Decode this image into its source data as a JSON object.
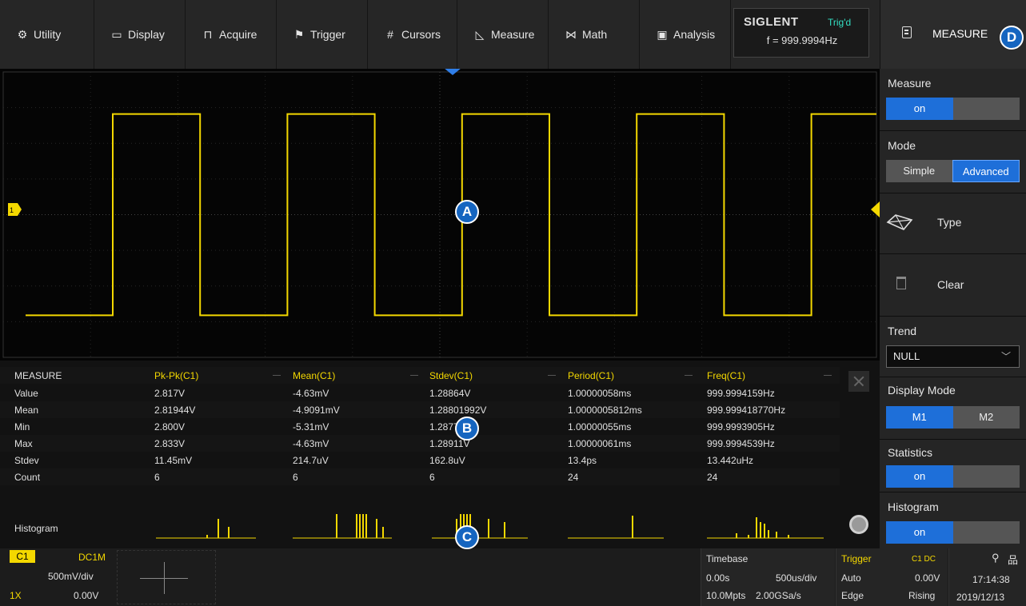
{
  "menu": [
    {
      "label": "Utility",
      "icon": "gear-icon"
    },
    {
      "label": "Display",
      "icon": "monitor-icon"
    },
    {
      "label": "Acquire",
      "icon": "acquire-icon"
    },
    {
      "label": "Trigger",
      "icon": "flag-icon"
    },
    {
      "label": "Cursors",
      "icon": "hash-icon"
    },
    {
      "label": "Measure",
      "icon": "measure-icon"
    },
    {
      "label": "Math",
      "icon": "math-icon"
    },
    {
      "label": "Analysis",
      "icon": "analysis-icon"
    }
  ],
  "brand": {
    "name": "SIGLENT",
    "trig_status": "Trig'd",
    "frequency": "f = 999.9994Hz"
  },
  "panel": {
    "title": "MEASURE",
    "measure_label": "Measure",
    "measure_state": "on",
    "mode_label": "Mode",
    "mode_simple": "Simple",
    "mode_advanced": "Advanced",
    "type_label": "Type",
    "clear_label": "Clear",
    "trend_label": "Trend",
    "trend_value": "NULL",
    "display_mode_label": "Display Mode",
    "display_m1": "M1",
    "display_m2": "M2",
    "statistics_label": "Statistics",
    "statistics_state": "on",
    "histogram_label": "Histogram",
    "histogram_state": "on"
  },
  "waveform": {
    "channel_marker": "1",
    "trace_color": "#f4d800",
    "high_level": 1.41,
    "low_level": -1.41,
    "period_ms": 1.0,
    "volts_per_div": 0.5,
    "time_per_div_us": 500
  },
  "measure": {
    "header": [
      "MEASURE",
      "Pk-Pk(C1)",
      "Mean(C1)",
      "Stdev(C1)",
      "Period(C1)",
      "Freq(C1)"
    ],
    "rows": [
      {
        "label": "Value",
        "cells": [
          "2.817V",
          "-4.63mV",
          "1.28864V",
          "1.00000058ms",
          "999.9994159Hz"
        ]
      },
      {
        "label": "Mean",
        "cells": [
          "2.81944V",
          "-4.9091mV",
          "1.28801992V",
          "1.0000005812ms",
          "999.999418770Hz"
        ]
      },
      {
        "label": "Min",
        "cells": [
          "2.800V",
          "-5.31mV",
          "1.28771V",
          "1.00000055ms",
          "999.9993905Hz"
        ]
      },
      {
        "label": "Max",
        "cells": [
          "2.833V",
          "-4.63mV",
          "1.28911V",
          "1.00000061ms",
          "999.9994539Hz"
        ]
      },
      {
        "label": "Stdev",
        "cells": [
          "11.45mV",
          "214.7uV",
          "162.8uV",
          "13.4ps",
          "13.442uHz"
        ]
      },
      {
        "label": "Count",
        "cells": [
          "6",
          "6",
          "6",
          "24",
          "24"
        ]
      }
    ],
    "histogram_label": "Histogram"
  },
  "channel": {
    "tag": "C1",
    "coupling": "DC1M",
    "scale": "500mV/div",
    "probe": "1X",
    "offset": "0.00V"
  },
  "timebase": {
    "label": "Timebase",
    "delay": "0.00s",
    "scale": "500us/div",
    "memory": "10.0Mpts",
    "sample_rate": "2.00GSa/s"
  },
  "trigger": {
    "label": "Trigger",
    "source": "C1 DC",
    "mode": "Auto",
    "level": "0.00V",
    "type": "Edge",
    "slope": "Rising"
  },
  "clock": {
    "time": "17:14:38",
    "date": "2019/12/13"
  },
  "callouts": [
    "A",
    "B",
    "C",
    "D"
  ]
}
